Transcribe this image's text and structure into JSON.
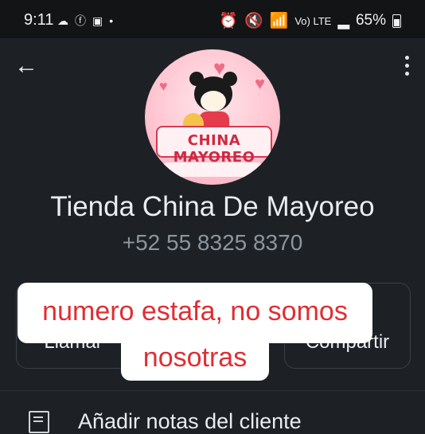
{
  "status_bar": {
    "time": "9:11",
    "battery_percent": "65%",
    "left_icons": [
      "cloud-icon",
      "facebook-icon",
      "gallery-icon",
      "dot-icon"
    ],
    "right_icons": [
      "alarm-icon",
      "mute-icon",
      "wifi-icon",
      "volte-icon",
      "signal-icon",
      "battery-icon"
    ],
    "volte_label": "Vo) LTE"
  },
  "header": {
    "back_icon": "back-arrow-icon",
    "menu_icon": "more-vert-icon"
  },
  "profile": {
    "avatar_logo_text": "CHINA MAYOREO",
    "name": "Tienda China De Mayoreo",
    "phone": "+52 55 8325 8370"
  },
  "actions": {
    "call_label": "Llamar",
    "share_label": "Compartir"
  },
  "overlay": {
    "line1": "numero estafa, no somos",
    "line2": "nosotras",
    "text_color": "#e02d33"
  },
  "list": {
    "notes_label": "Añadir notas del cliente"
  },
  "colors": {
    "background": "#1d2126",
    "status_bar": "#121416",
    "secondary_text": "#8d959c"
  }
}
